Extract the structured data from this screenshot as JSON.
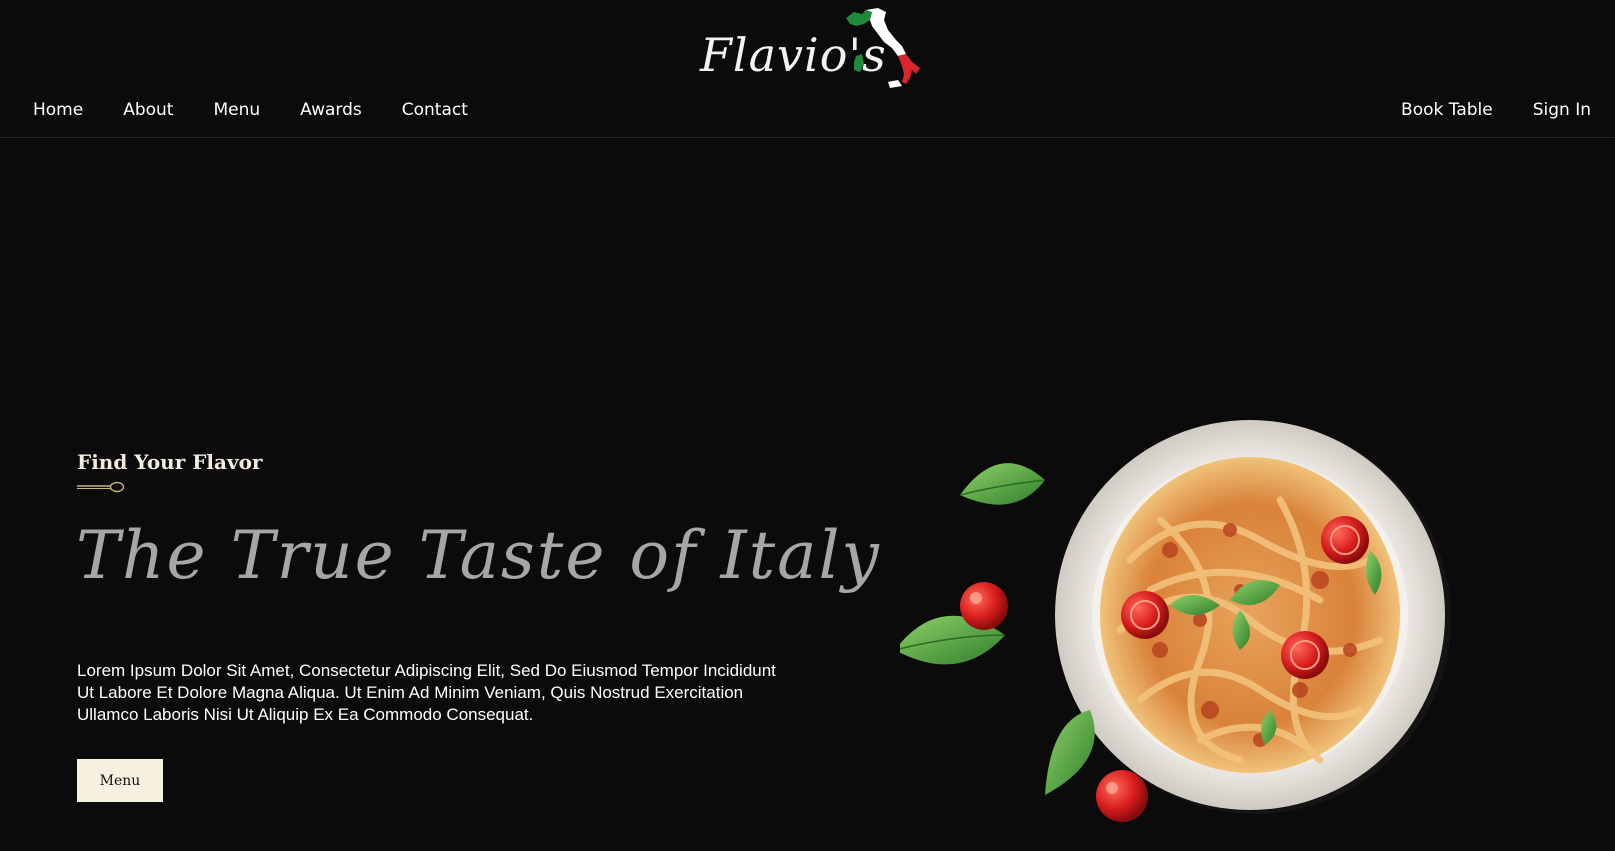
{
  "brand": {
    "logo_text": "Flavio's",
    "flag_colors": {
      "green": "#1f8a3a",
      "white": "#ffffff",
      "red": "#d7262e"
    }
  },
  "nav": {
    "left": [
      "Home",
      "About",
      "Menu",
      "Awards",
      "Contact"
    ],
    "right": [
      "Book Table",
      "Sign In"
    ]
  },
  "hero": {
    "eyebrow": "Find Your Flavor",
    "title": "The True Taste of Italy",
    "description": "Lorem Ipsum Dolor Sit Amet, Consectetur Adipiscing Elit, Sed Do Eiusmod Tempor Incididunt Ut Labore Et Dolore Magna Aliqua. Ut Enim Ad Minim Veniam, Quis Nostrud Exercitation Ullamco Laboris Nisi Ut Aliquip Ex Ea Commodo Consequat.",
    "button_label": "Menu"
  },
  "icons": {
    "spoon": "spoon-icon",
    "map": "italy-map-icon",
    "dish": "pasta-dish-image"
  },
  "colors": {
    "background": "#0b0b0c",
    "accent_cream": "#f6f0e0",
    "title_gray": "#a6a6a6",
    "spoon_gold": "#c9b27a"
  }
}
